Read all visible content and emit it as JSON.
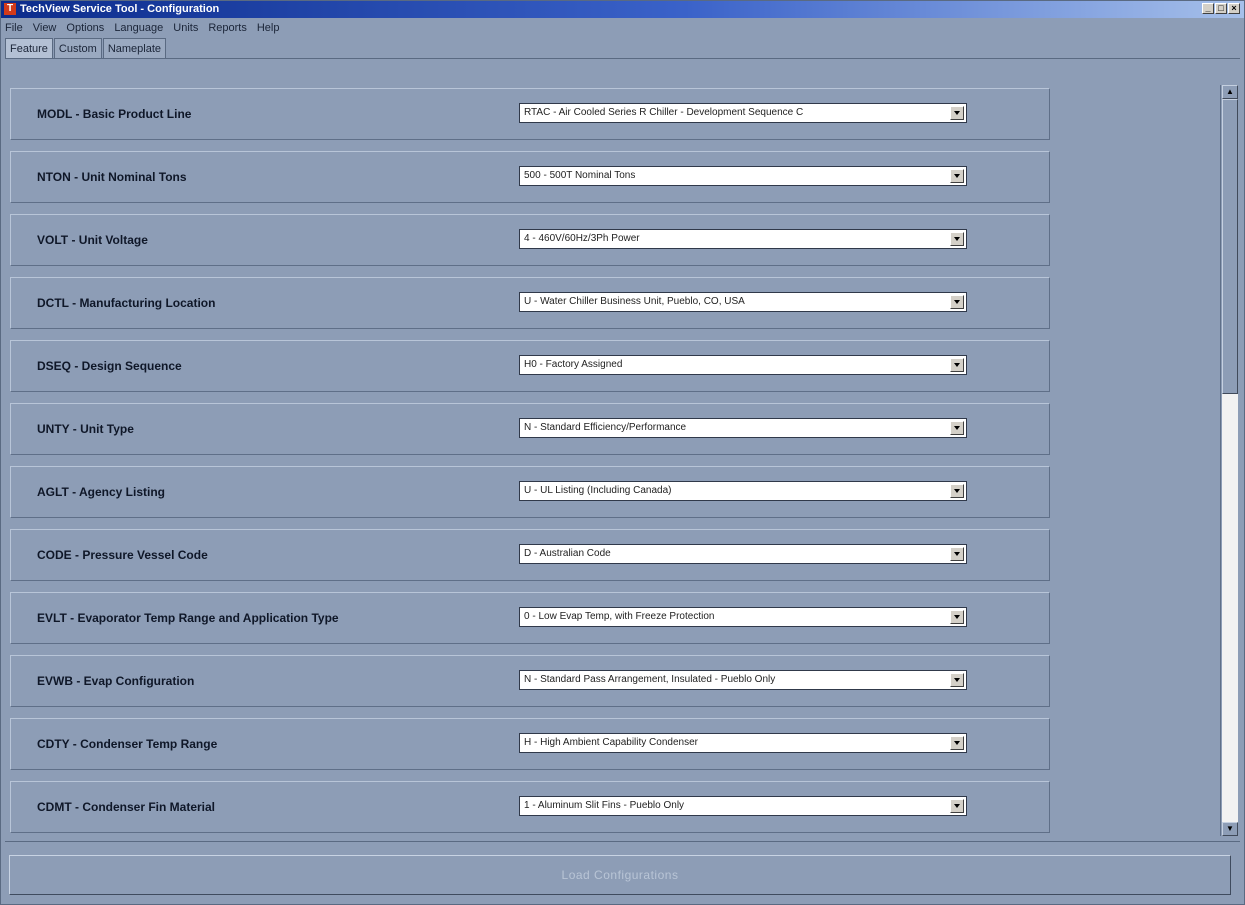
{
  "window": {
    "title": "TechView Service Tool - Configuration",
    "app_icon_glyph": "T",
    "controls": {
      "minimize": "_",
      "maximize": "□",
      "close": "×"
    }
  },
  "menu": [
    "File",
    "View",
    "Options",
    "Language",
    "Units",
    "Reports",
    "Help"
  ],
  "tabs": [
    {
      "label": "Feature",
      "active": true
    },
    {
      "label": "Custom",
      "active": false
    },
    {
      "label": "Nameplate",
      "active": false
    }
  ],
  "rows": [
    {
      "label": "MODL - Basic Product Line",
      "value": "RTAC - Air Cooled Series R Chiller - Development Sequence C"
    },
    {
      "label": "NTON - Unit Nominal Tons",
      "value": "500 - 500T Nominal Tons"
    },
    {
      "label": "VOLT - Unit Voltage",
      "value": "4 - 460V/60Hz/3Ph Power"
    },
    {
      "label": "DCTL - Manufacturing Location",
      "value": "U - Water Chiller Business Unit, Pueblo, CO, USA"
    },
    {
      "label": "DSEQ - Design Sequence",
      "value": "H0 - Factory Assigned"
    },
    {
      "label": "UNTY - Unit Type",
      "value": "N - Standard Efficiency/Performance"
    },
    {
      "label": "AGLT - Agency Listing",
      "value": "U - UL Listing (Including Canada)"
    },
    {
      "label": "CODE - Pressure Vessel Code",
      "value": "D - Australian Code"
    },
    {
      "label": "EVLT - Evaporator Temp Range and Application Type",
      "value": "0 - Low Evap Temp, with Freeze Protection"
    },
    {
      "label": "EVWB - Evap Configuration",
      "value": "N - Standard Pass Arrangement, Insulated - Pueblo Only"
    },
    {
      "label": "CDTY - Condenser Temp Range",
      "value": "H - High Ambient Capability Condenser"
    },
    {
      "label": "CDMT - Condenser Fin Material",
      "value": "1 - Aluminum Slit Fins - Pueblo Only"
    }
  ],
  "footer": {
    "load_button_label": "Load Configurations"
  },
  "scrollbar": {
    "up_glyph": "▲",
    "down_glyph": "▼"
  },
  "colors": {
    "background": "#8d9db6",
    "titlebar_start": "#0c2c8c",
    "titlebar_end": "#a6c0ea"
  }
}
